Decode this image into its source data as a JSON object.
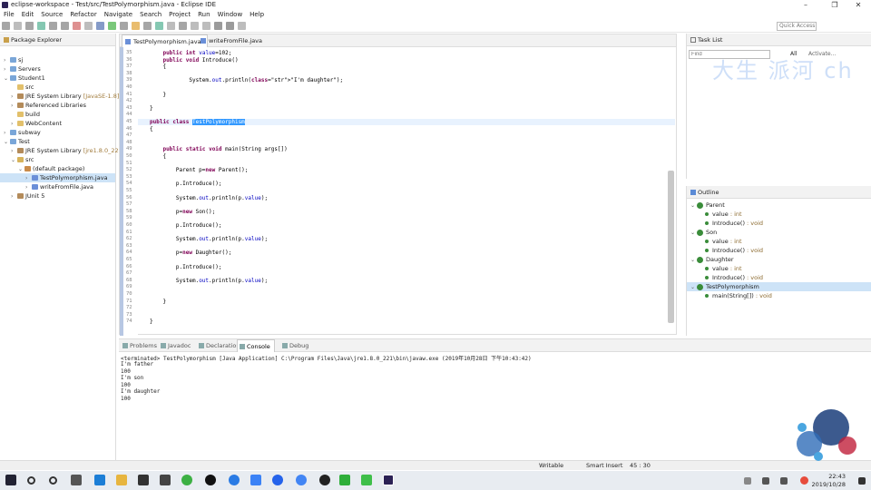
{
  "window": {
    "title": "eclipse-workspace - Test/src/TestPolymorphism.java - Eclipse IDE"
  },
  "menus": [
    "File",
    "Edit",
    "Source",
    "Refactor",
    "Navigate",
    "Search",
    "Project",
    "Run",
    "Window",
    "Help"
  ],
  "quick_access": "Quick Access",
  "package_explorer": {
    "tab_label": "Package Explorer",
    "tree": [
      {
        "depth": 0,
        "twisty": ">",
        "icon": "project-icon",
        "label": "sj"
      },
      {
        "depth": 0,
        "twisty": ">",
        "icon": "project-icon",
        "label": "Servers"
      },
      {
        "depth": 0,
        "twisty": "v",
        "icon": "project-icon",
        "label": "Student1"
      },
      {
        "depth": 1,
        "twisty": "",
        "icon": "folder-icon",
        "label": "src"
      },
      {
        "depth": 1,
        "twisty": ">",
        "icon": "library-icon",
        "label": "JRE System Library",
        "decor": " [JavaSE-1.8]"
      },
      {
        "depth": 1,
        "twisty": ">",
        "icon": "library-icon",
        "label": "Referenced Libraries"
      },
      {
        "depth": 1,
        "twisty": "",
        "icon": "folder-icon",
        "label": "build"
      },
      {
        "depth": 1,
        "twisty": ">",
        "icon": "folder-icon",
        "label": "WebContent"
      },
      {
        "depth": 0,
        "twisty": ">",
        "icon": "project-icon",
        "label": "subway"
      },
      {
        "depth": 0,
        "twisty": "v",
        "icon": "project-icon",
        "label": "Test"
      },
      {
        "depth": 1,
        "twisty": ">",
        "icon": "library-icon",
        "label": "JRE System Library",
        "decor": " [jre1.8.0_221]"
      },
      {
        "depth": 1,
        "twisty": "v",
        "icon": "src-folder-icon",
        "label": "src"
      },
      {
        "depth": 2,
        "twisty": "v",
        "icon": "package-icon",
        "label": "(default package)"
      },
      {
        "depth": 3,
        "twisty": ">",
        "icon": "java-file-icon",
        "label": "TestPolymorphism.java",
        "selected": true
      },
      {
        "depth": 3,
        "twisty": ">",
        "icon": "java-file-icon",
        "label": "writeFromFile.java"
      },
      {
        "depth": 1,
        "twisty": ">",
        "icon": "library-icon",
        "label": "JUnit 5"
      }
    ]
  },
  "editor": {
    "tabs": [
      {
        "label": "TestPolymorphism.java",
        "active": true
      },
      {
        "label": "writeFromFile.java",
        "active": false
      }
    ],
    "lines": [
      {
        "n": "35",
        "code": "    public int value=102;"
      },
      {
        "n": "36",
        "code": "    public void Introduce()"
      },
      {
        "n": "37",
        "code": "    {"
      },
      {
        "n": "38",
        "code": ""
      },
      {
        "n": "39",
        "code": "            System.out.println(\"I'm daughter\");"
      },
      {
        "n": "40",
        "code": ""
      },
      {
        "n": "41",
        "code": "    }"
      },
      {
        "n": "42",
        "code": ""
      },
      {
        "n": "43",
        "code": "}"
      },
      {
        "n": "44",
        "code": ""
      },
      {
        "n": "45",
        "code": "public class TestPolymorphism"
      },
      {
        "n": "46",
        "code": "{"
      },
      {
        "n": "47",
        "code": ""
      },
      {
        "n": "48",
        "code": ""
      },
      {
        "n": "49",
        "code": "    public static void main(String args[])"
      },
      {
        "n": "50",
        "code": "    {"
      },
      {
        "n": "51",
        "code": ""
      },
      {
        "n": "52",
        "code": "        Parent p=new Parent();"
      },
      {
        "n": "53",
        "code": ""
      },
      {
        "n": "54",
        "code": "        p.Introduce();"
      },
      {
        "n": "55",
        "code": ""
      },
      {
        "n": "56",
        "code": "        System.out.println(p.value);"
      },
      {
        "n": "57",
        "code": ""
      },
      {
        "n": "58",
        "code": "        p=new Son();"
      },
      {
        "n": "59",
        "code": ""
      },
      {
        "n": "60",
        "code": "        p.Introduce();"
      },
      {
        "n": "61",
        "code": ""
      },
      {
        "n": "62",
        "code": "        System.out.println(p.value);"
      },
      {
        "n": "63",
        "code": ""
      },
      {
        "n": "64",
        "code": "        p=new Daughter();"
      },
      {
        "n": "65",
        "code": ""
      },
      {
        "n": "66",
        "code": "        p.Introduce();"
      },
      {
        "n": "67",
        "code": ""
      },
      {
        "n": "68",
        "code": "        System.out.println(p.value);"
      },
      {
        "n": "69",
        "code": ""
      },
      {
        "n": "70",
        "code": ""
      },
      {
        "n": "71",
        "code": "    }"
      },
      {
        "n": "72",
        "code": ""
      },
      {
        "n": "73",
        "code": ""
      },
      {
        "n": "74",
        "code": "}"
      }
    ]
  },
  "task_list": {
    "tab_label": "Task List",
    "find_placeholder": "Find",
    "all": "All",
    "activate": "Activate..."
  },
  "outline": {
    "tab_label": "Outline",
    "items": [
      {
        "depth": 0,
        "label": "Parent",
        "type": ""
      },
      {
        "depth": 1,
        "label": "value",
        "type": " : int"
      },
      {
        "depth": 1,
        "label": "Introduce()",
        "type": " : void"
      },
      {
        "depth": 0,
        "label": "Son",
        "type": ""
      },
      {
        "depth": 1,
        "label": "value",
        "type": " : int"
      },
      {
        "depth": 1,
        "label": "Introduce()",
        "type": " : void"
      },
      {
        "depth": 0,
        "label": "Daughter",
        "type": ""
      },
      {
        "depth": 1,
        "label": "value",
        "type": " : int"
      },
      {
        "depth": 1,
        "label": "Introduce()",
        "type": " : void"
      },
      {
        "depth": 0,
        "label": "TestPolymorphism",
        "type": "",
        "selected": true
      },
      {
        "depth": 1,
        "label": "main(String[])",
        "type": " : void"
      }
    ]
  },
  "console": {
    "tabs": [
      "Problems",
      "Javadoc",
      "Declaration",
      "Console",
      "Debug"
    ],
    "active_tab": "Console",
    "header": "<terminated> TestPolymorphism [Java Application] C:\\Program Files\\Java\\jre1.8.0_221\\bin\\javaw.exe (2019年10月28日 下午10:43:42)",
    "output": [
      "I'm father",
      "100",
      "I'm son",
      "100",
      "I'm daughter",
      "100"
    ]
  },
  "status": {
    "writable": "Writable",
    "insert_mode": "Smart Insert",
    "position": "45 : 30"
  },
  "watermark": "大生 派河 ch",
  "taskbar": {
    "time": "22:43",
    "date": "2019/10/28"
  },
  "colors": {
    "keyword": "#7f0055",
    "string": "#2a00ff",
    "field": "#0000c0",
    "selection": "#3399ff"
  }
}
